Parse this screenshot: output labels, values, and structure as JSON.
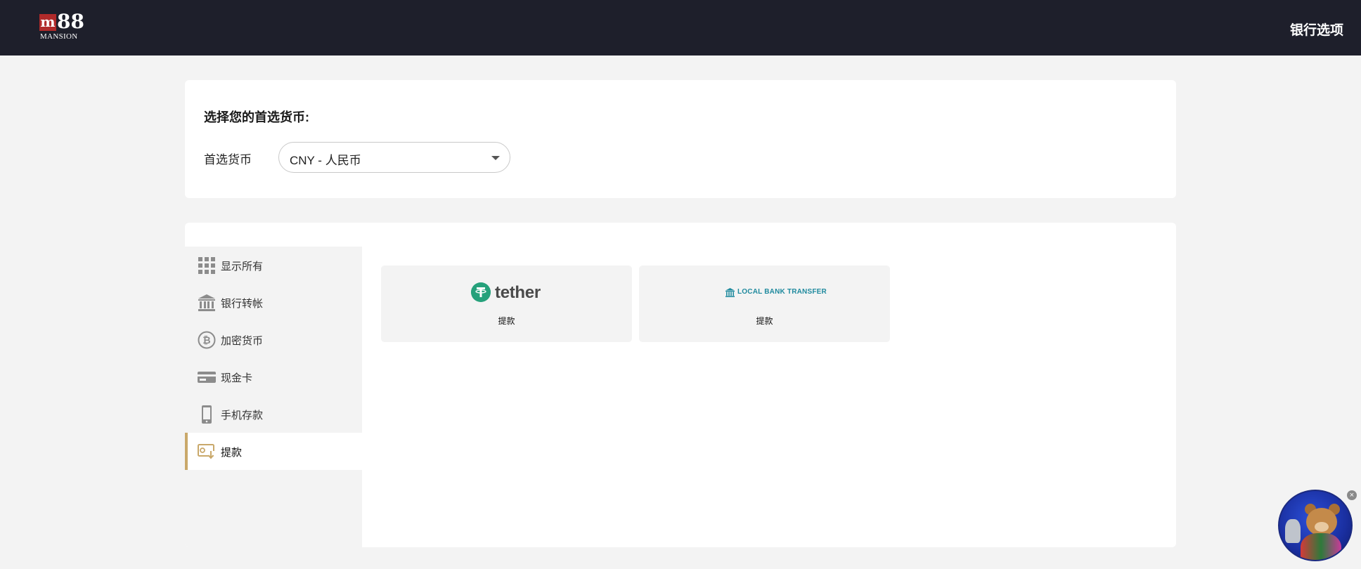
{
  "header": {
    "logo_m": "m",
    "logo_num": "88",
    "logo_text": "MANSION",
    "title": "银行选项"
  },
  "currency": {
    "heading": "选择您的首选货币:",
    "label": "首选货币",
    "selected": "CNY - 人民币"
  },
  "sidebar": {
    "items": [
      {
        "label": "显示所有",
        "icon": "grid-icon"
      },
      {
        "label": "银行转帐",
        "icon": "bank-icon"
      },
      {
        "label": "加密货币",
        "icon": "bitcoin-icon"
      },
      {
        "label": "现金卡",
        "icon": "card-icon"
      },
      {
        "label": "手机存款",
        "icon": "phone-icon"
      },
      {
        "label": "提款",
        "icon": "withdraw-icon",
        "active": true
      }
    ]
  },
  "methods": [
    {
      "brand": "tether",
      "caption": "提款",
      "brand_color": "#26a17b"
    },
    {
      "brand": "LOCAL BANK TRANSFER",
      "caption": "提款",
      "brand_color": "#1f8a9e"
    }
  ],
  "colors": {
    "header_bg": "#1e1f2b",
    "accent": "#c9a86a",
    "page_bg": "#f3f3f3"
  }
}
